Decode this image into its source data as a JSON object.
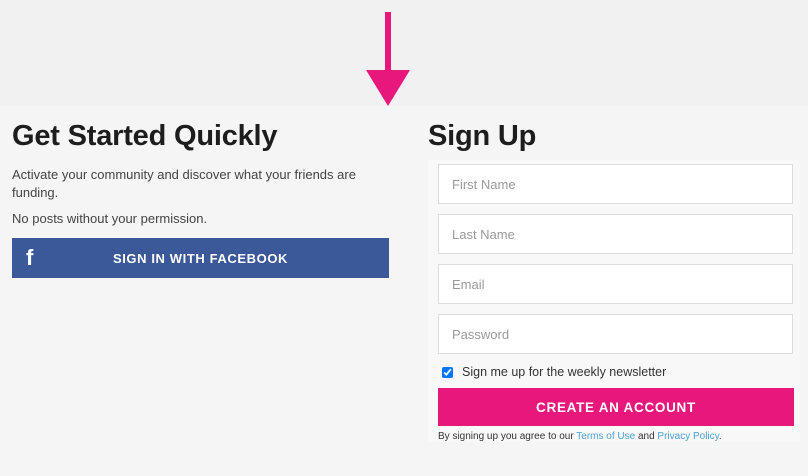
{
  "colors": {
    "accent_pink": "#e8177b",
    "facebook_blue": "#3b5998",
    "link_blue": "#4aa3d6"
  },
  "indicator": {
    "icon": "down-arrow-icon",
    "color": "#e8177b"
  },
  "quick_start": {
    "title": "Get Started Quickly",
    "description": "Activate your community and discover what your friends are funding.",
    "privacy_note": "No posts without your permission.",
    "facebook_button": {
      "icon": "facebook-icon",
      "icon_glyph": "f",
      "label": "SIGN IN WITH FACEBOOK"
    }
  },
  "signup": {
    "title": "Sign Up",
    "fields": {
      "first_name": {
        "placeholder": "First Name",
        "value": ""
      },
      "last_name": {
        "placeholder": "Last Name",
        "value": ""
      },
      "email": {
        "placeholder": "Email",
        "value": ""
      },
      "password": {
        "placeholder": "Password",
        "value": ""
      }
    },
    "newsletter": {
      "label": "Sign me up for the weekly newsletter",
      "checked": true
    },
    "create_button": {
      "label": "CREATE AN ACCOUNT"
    },
    "terms": {
      "prefix": "By signing up you agree to our",
      "terms_link": "Terms of Use",
      "conjunction": "and",
      "privacy_link": "Privacy Policy",
      "suffix": "."
    }
  }
}
